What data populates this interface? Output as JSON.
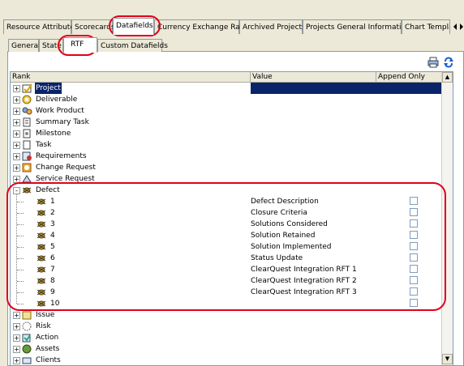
{
  "top_tabs": [
    "Resource Attributes",
    "Scorecards",
    "Datafields",
    "Currency Exchange Rates",
    "Archived Projects",
    "Projects General Information",
    "Chart Templat"
  ],
  "sub_tabs": [
    "General",
    "State",
    "RTF",
    "Custom Datafields"
  ],
  "grid": {
    "headers": {
      "rank": "Rank",
      "value": "Value",
      "append": "Append Only"
    },
    "rows": [
      {
        "label": "Project",
        "value": "",
        "level": 0,
        "icon": "project-icon",
        "selected": true,
        "expand": "+"
      },
      {
        "label": "Deliverable",
        "value": "",
        "level": 0,
        "icon": "deliverable-icon",
        "expand": "+"
      },
      {
        "label": "Work Product",
        "value": "",
        "level": 0,
        "icon": "work-product-icon",
        "expand": "+"
      },
      {
        "label": "Summary Task",
        "value": "",
        "level": 0,
        "icon": "summary-task-icon",
        "expand": "+"
      },
      {
        "label": "Milestone",
        "value": "",
        "level": 0,
        "icon": "milestone-icon",
        "expand": "+"
      },
      {
        "label": "Task",
        "value": "",
        "level": 0,
        "icon": "task-icon",
        "expand": "+"
      },
      {
        "label": "Requirements",
        "value": "",
        "level": 0,
        "icon": "requirements-icon",
        "expand": "+"
      },
      {
        "label": "Change Request",
        "value": "",
        "level": 0,
        "icon": "change-request-icon",
        "expand": "+"
      },
      {
        "label": "Service Request",
        "value": "",
        "level": 0,
        "icon": "service-request-icon",
        "expand": "+"
      },
      {
        "label": "Defect",
        "value": "",
        "level": 0,
        "icon": "defect-icon",
        "expand": "-"
      },
      {
        "label": "1",
        "value": "Defect Description",
        "level": 1,
        "icon": "defect-icon",
        "checkbox": true
      },
      {
        "label": "2",
        "value": "Closure Criteria",
        "level": 1,
        "icon": "defect-icon",
        "checkbox": true
      },
      {
        "label": "3",
        "value": "Solutions Considered",
        "level": 1,
        "icon": "defect-icon",
        "checkbox": true
      },
      {
        "label": "4",
        "value": "Solution Retained",
        "level": 1,
        "icon": "defect-icon",
        "checkbox": true
      },
      {
        "label": "5",
        "value": "Solution Implemented",
        "level": 1,
        "icon": "defect-icon",
        "checkbox": true
      },
      {
        "label": "6",
        "value": "Status  Update",
        "level": 1,
        "icon": "defect-icon",
        "checkbox": true
      },
      {
        "label": "7",
        "value": "ClearQuest Integration RFT 1",
        "level": 1,
        "icon": "defect-icon",
        "checkbox": true
      },
      {
        "label": "8",
        "value": "ClearQuest Integration RFT 2",
        "level": 1,
        "icon": "defect-icon",
        "checkbox": true
      },
      {
        "label": "9",
        "value": "ClearQuest Integration RFT 3",
        "level": 1,
        "icon": "defect-icon",
        "checkbox": true
      },
      {
        "label": "10",
        "value": "",
        "level": 1,
        "icon": "defect-icon",
        "checkbox": true
      },
      {
        "label": "Issue",
        "value": "",
        "level": 0,
        "icon": "issue-icon",
        "expand": "+"
      },
      {
        "label": "Risk",
        "value": "",
        "level": 0,
        "icon": "risk-icon",
        "expand": "+"
      },
      {
        "label": "Action",
        "value": "",
        "level": 0,
        "icon": "action-icon",
        "expand": "+"
      },
      {
        "label": "Assets",
        "value": "",
        "level": 0,
        "icon": "assets-icon",
        "expand": "+"
      },
      {
        "label": "Clients",
        "value": "",
        "level": 0,
        "icon": "clients-icon",
        "expand": "+"
      }
    ]
  },
  "colors": {
    "highlight": "#e0001a",
    "selection": "#0a246a"
  }
}
